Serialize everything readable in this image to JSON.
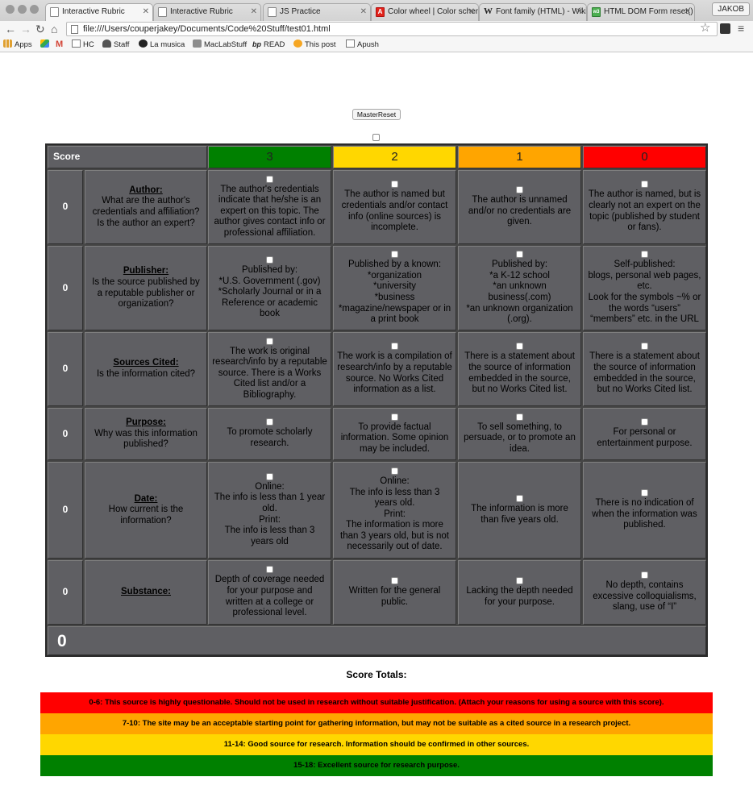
{
  "browser": {
    "tabs": [
      {
        "title": "Interactive Rubric",
        "favicon": "page-icon",
        "active": true
      },
      {
        "title": "Interactive Rubric",
        "favicon": "page-icon",
        "active": false
      },
      {
        "title": "JS Practice",
        "favicon": "page-icon",
        "active": false
      },
      {
        "title": "Color wheel | Color schem",
        "favicon": "adobe-icon",
        "active": false
      },
      {
        "title": "Font family (HTML) - Wiki",
        "favicon": "wikipedia-icon",
        "active": false
      },
      {
        "title": "HTML DOM Form reset() M",
        "favicon": "w3schools-icon",
        "active": false
      }
    ],
    "profile": "JAKOB",
    "url": "file:///Users/couperjakey/Documents/Code%20Stuff/test01.html",
    "bookmarks": [
      {
        "label": "Apps",
        "icon": "apps-grid-icon",
        "color": "#e0a030"
      },
      {
        "label": "",
        "icon": "google-drive-icon",
        "color": "#3b9a4a"
      },
      {
        "label": "",
        "icon": "gmail-icon",
        "color": "#d44638"
      },
      {
        "label": "HC",
        "icon": "page-icon",
        "color": "#ffffff"
      },
      {
        "label": "Staff",
        "icon": "staff-icon",
        "color": "#444444"
      },
      {
        "label": "La musica",
        "icon": "spotify-icon",
        "color": "#1db954"
      },
      {
        "label": "MacLabStuff",
        "icon": "folder-icon",
        "color": "#8a8a8a"
      },
      {
        "label": "READ",
        "icon": "bp-icon",
        "color": "#333333"
      },
      {
        "label": "This post",
        "icon": "m-icon",
        "color": "#f5a623"
      },
      {
        "label": "Apush",
        "icon": "page-icon",
        "color": "#ffffff"
      }
    ]
  },
  "page": {
    "reset_button": "MasterReset",
    "rubric": {
      "score_header": "Score",
      "levels": [
        {
          "label": "3",
          "color": "#008000"
        },
        {
          "label": "2",
          "color": "#ffd700"
        },
        {
          "label": "1",
          "color": "#ffa500"
        },
        {
          "label": "0",
          "color": "#ff0000"
        }
      ],
      "rows": [
        {
          "score": "0",
          "title": "Author:",
          "question": "What are the author's credentials and affiliation? Is the author an expert?",
          "cells": [
            "The author's credentials indicate that he/she is an expert on this topic. The author gives contact info or professional affiliation.",
            "The author is named but credentials and/or contact info (online sources) is incomplete.",
            "The author is unnamed and/or no credentials are given.",
            "The author is named, but is clearly not an expert on the topic (published by student or fans)."
          ]
        },
        {
          "score": "0",
          "title": "Publisher:",
          "question": "Is the source published by a reputable publisher or organization?",
          "cells": [
            "Published by:\n*U.S. Government (.gov)\n*Scholarly Journal or in a Reference or academic book",
            "Published by a known:\n*organization\n*university\n*business\n*magazine/newspaper or in a print book",
            "Published by:\n*a K-12 school\n*an unknown business(.com)\n*an unknown organization (.org).",
            "Self-published:\nblogs, personal web pages, etc.\nLook for the symbols ~% or the words “users” “members” etc. in the URL"
          ]
        },
        {
          "score": "0",
          "title": "Sources Cited:",
          "question": "Is the information cited?",
          "cells": [
            "The work is original research/info by a reputable source. There is a Works Cited list and/or a Bibliography.",
            "The work is a compilation of research/info by a reputable source. No Works Cited information as a list.",
            "There is a statement about the source of information embedded in the source, but no Works Cited list.",
            "There is a statement about the source of information embedded in the source, but no Works Cited list."
          ]
        },
        {
          "score": "0",
          "title": "Purpose:",
          "question": "Why was this information published?",
          "cells": [
            "To promote scholarly research.",
            "To provide factual information. Some opinion may be included.",
            "To sell something, to persuade, or to promote an idea.",
            "For personal or entertainment purpose."
          ]
        },
        {
          "score": "0",
          "title": "Date:",
          "question": "How current is the information?",
          "cells": [
            "Online:\nThe info is less than 1 year old.\nPrint:\nThe info is less than 3 years old",
            "Online:\nThe info is less than 3 years old.\nPrint:\nThe information is more than 3 years old, but is not necessarily out of date.",
            "The information is more than five years old.",
            "There is no indication of when the information was published."
          ]
        },
        {
          "score": "0",
          "title": "Substance:",
          "question": "",
          "cells": [
            "Depth of coverage needed for your purpose and written at a college or professional level.",
            "Written for the general public.",
            "Lacking the depth needed for your purpose.",
            "No depth, contains excessive colloquialisms, slang, use of “I”"
          ]
        }
      ],
      "total": "0"
    },
    "totals_heading": "Score Totals:",
    "bands": [
      {
        "text": "0-6: This source is highly questionable. Should not be used in research without suitable justification. (Attach your reasons for using a source with this score).",
        "color": "#ff0000"
      },
      {
        "text": "7-10: The site may be an acceptable starting point for gathering information, but may not be suitable as a cited source in a research project.",
        "color": "#ffa500"
      },
      {
        "text": "11-14: Good source for research. Information should be confirmed in other sources.",
        "color": "#ffd700"
      },
      {
        "text": "15-18: Excellent source for research purpose.",
        "color": "#008000"
      }
    ]
  }
}
